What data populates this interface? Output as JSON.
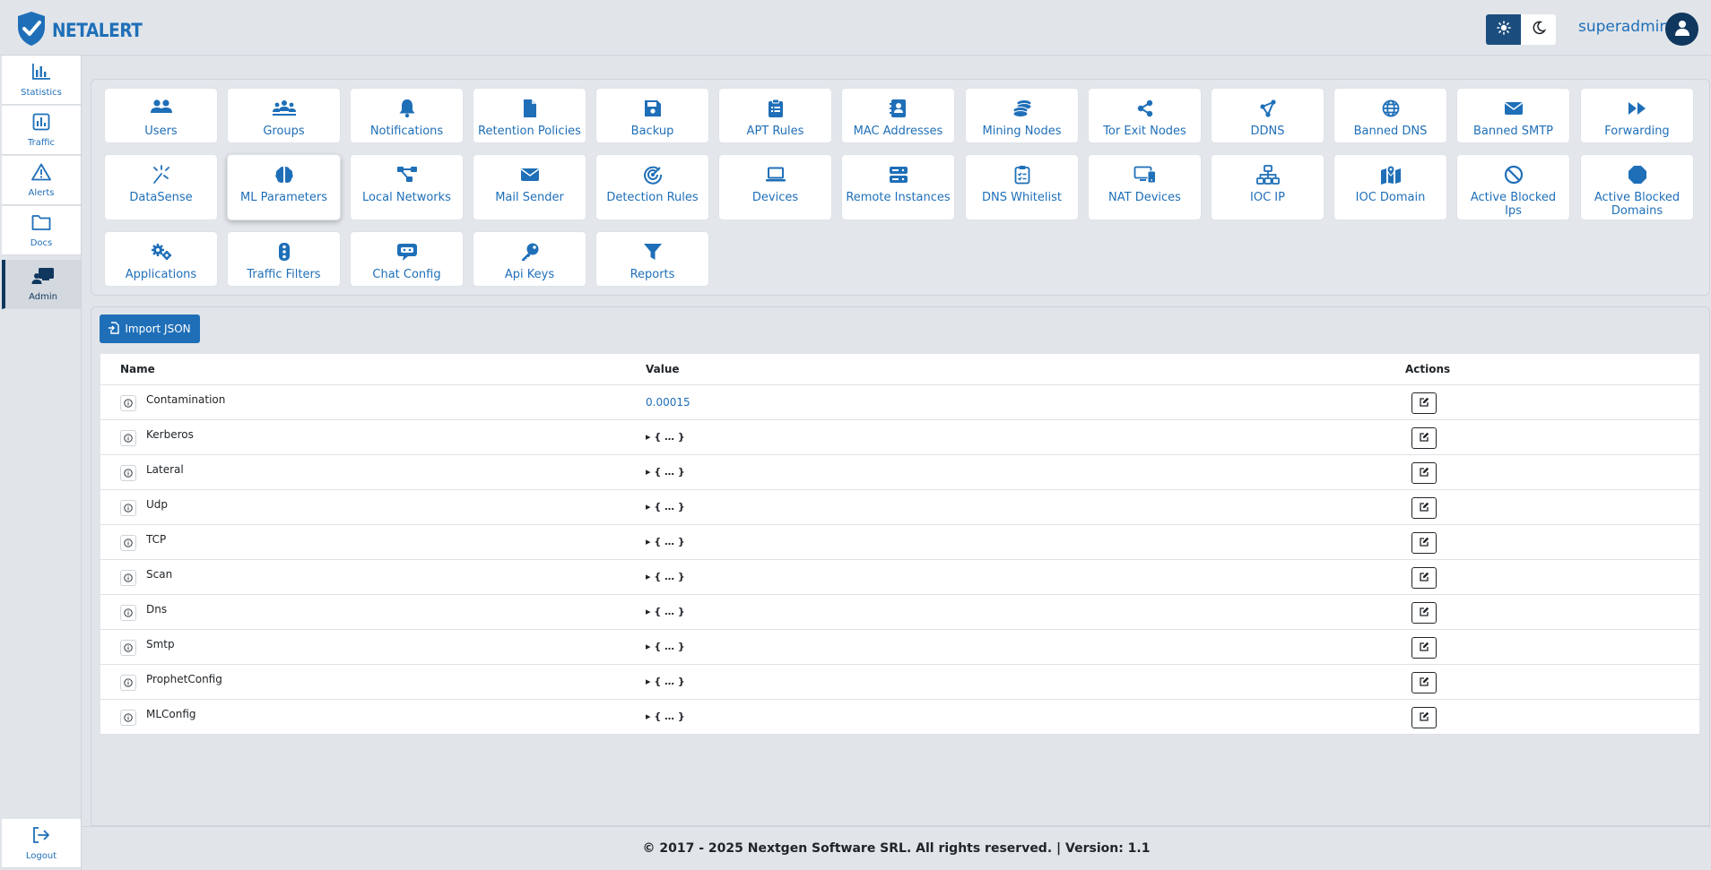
{
  "app": {
    "logo_text": "NETALERT",
    "brand_color": "#1f6fb8",
    "dark_accent": "#10375e"
  },
  "header": {
    "user_name": "superadmin",
    "theme_light_icon": "sun-icon",
    "theme_dark_icon": "moon-icon",
    "avatar_icon": "user-icon"
  },
  "sidebar": {
    "items": [
      {
        "label": "Statistics",
        "icon": "bar-chart-icon",
        "active": false
      },
      {
        "label": "Traffic",
        "icon": "chart-box-icon",
        "active": false
      },
      {
        "label": "Alerts",
        "icon": "warning-icon",
        "active": false
      },
      {
        "label": "Docs",
        "icon": "folder-icon",
        "active": false
      },
      {
        "label": "Admin",
        "icon": "presentation-user-icon",
        "active": true
      }
    ],
    "logout": {
      "label": "Logout",
      "icon": "logout-icon"
    }
  },
  "admin_tiles": [
    {
      "label": "Users",
      "icon": "users-icon"
    },
    {
      "label": "Groups",
      "icon": "groups-icon"
    },
    {
      "label": "Notifications",
      "icon": "bell-icon"
    },
    {
      "label": "Retention Policies",
      "icon": "file-icon"
    },
    {
      "label": "Backup",
      "icon": "floppy-icon"
    },
    {
      "label": "APT Rules",
      "icon": "clipboard-list-icon"
    },
    {
      "label": "MAC Addresses",
      "icon": "address-book-icon"
    },
    {
      "label": "Mining Nodes",
      "icon": "coins-icon"
    },
    {
      "label": "Tor Exit Nodes",
      "icon": "share-nodes-icon"
    },
    {
      "label": "DDNS",
      "icon": "network-icon"
    },
    {
      "label": "Banned DNS",
      "icon": "globe-icon"
    },
    {
      "label": "Banned SMTP",
      "icon": "envelope-icon"
    },
    {
      "label": "Forwarding",
      "icon": "forward-icon"
    },
    {
      "label": "DataSense",
      "icon": "wand-icon"
    },
    {
      "label": "ML Parameters",
      "icon": "brain-icon",
      "active": true
    },
    {
      "label": "Local Networks",
      "icon": "diagram-icon"
    },
    {
      "label": "Mail Sender",
      "icon": "envelope-icon"
    },
    {
      "label": "Detection Rules",
      "icon": "radar-icon"
    },
    {
      "label": "Devices",
      "icon": "laptop-icon"
    },
    {
      "label": "Remote Instances",
      "icon": "server-icon"
    },
    {
      "label": "DNS Whitelist",
      "icon": "clipboard-check-icon"
    },
    {
      "label": "NAT Devices",
      "icon": "desktop-mobile-icon"
    },
    {
      "label": "IOC IP",
      "icon": "sitemap-icon"
    },
    {
      "label": "IOC Domain",
      "icon": "map-location-icon"
    },
    {
      "label": "Active Blocked Ips",
      "icon": "ban-icon"
    },
    {
      "label": "Active Blocked Domains",
      "icon": "stop-octagon-icon"
    },
    {
      "label": "Applications",
      "icon": "gears-icon"
    },
    {
      "label": "Traffic Filters",
      "icon": "traffic-light-icon"
    },
    {
      "label": "Chat Config",
      "icon": "chat-robot-icon"
    },
    {
      "label": "Api Keys",
      "icon": "key-icon"
    },
    {
      "label": "Reports",
      "icon": "filter-icon"
    }
  ],
  "import_button": {
    "label": "Import JSON",
    "icon": "file-import-icon"
  },
  "table": {
    "headers": {
      "name": "Name",
      "value": "Value",
      "actions": "Actions"
    },
    "rows": [
      {
        "name": "Contamination",
        "value": "0.00015",
        "type": "number"
      },
      {
        "name": "Kerberos",
        "value": "▸ { … }",
        "type": "object"
      },
      {
        "name": "Lateral",
        "value": "▸ { … }",
        "type": "object"
      },
      {
        "name": "Udp",
        "value": "▸ { … }",
        "type": "object"
      },
      {
        "name": "TCP",
        "value": "▸ { … }",
        "type": "object"
      },
      {
        "name": "Scan",
        "value": "▸ { … }",
        "type": "object"
      },
      {
        "name": "Dns",
        "value": "▸ { … }",
        "type": "object"
      },
      {
        "name": "Smtp",
        "value": "▸ { … }",
        "type": "object"
      },
      {
        "name": "ProphetConfig",
        "value": "▸ { … }",
        "type": "object"
      },
      {
        "name": "MLConfig",
        "value": "▸ { … }",
        "type": "object"
      }
    ]
  },
  "footer": {
    "text": "© 2017 - 2025 Nextgen Software SRL. All rights reserved. | Version: 1.1"
  }
}
